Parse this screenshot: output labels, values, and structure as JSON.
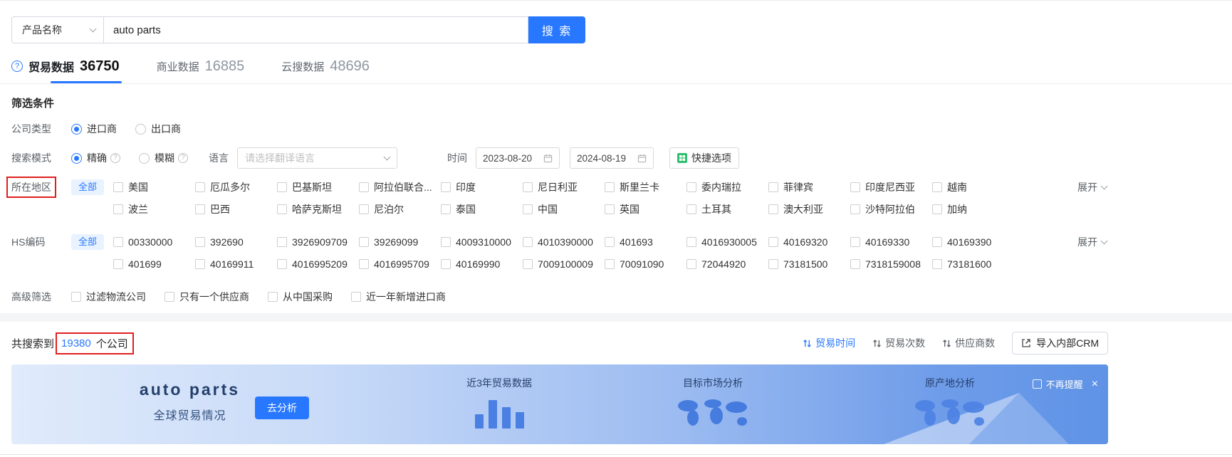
{
  "colors": {
    "primary": "#2878ff",
    "quick_icon_green": "#2fbf6e",
    "annotation_red": "#e01f1f"
  },
  "icons": {
    "help": "?",
    "info": "?",
    "close": "×"
  },
  "search_bar": {
    "category": "产品名称",
    "query": "auto parts",
    "button": "搜 索"
  },
  "tabs": [
    {
      "label": "贸易数据",
      "count": "36750"
    },
    {
      "label": "商业数据",
      "count": "16885"
    },
    {
      "label": "云搜数据",
      "count": "48696"
    }
  ],
  "filters": {
    "title": "筛选条件",
    "company_type": {
      "label": "公司类型",
      "options": [
        {
          "label": "进口商",
          "selected": true
        },
        {
          "label": "出口商",
          "selected": false
        }
      ]
    },
    "search_mode": {
      "label": "搜索模式",
      "options": [
        {
          "label": "精确",
          "selected": true
        },
        {
          "label": "模糊",
          "selected": false
        }
      ]
    },
    "language": {
      "label": "语言",
      "placeholder": "请选择翻译语言"
    },
    "time": {
      "label": "时间",
      "start": "2023-08-20",
      "end": "2024-08-19"
    },
    "quick_options_label": "快捷选项",
    "region": {
      "label": "所在地区",
      "all_label": "全部",
      "expand_label": "展开",
      "row1": [
        "美国",
        "厄瓜多尔",
        "巴基斯坦",
        "阿拉伯联合...",
        "印度",
        "尼日利亚",
        "斯里兰卡",
        "委内瑞拉",
        "菲律宾",
        "印度尼西亚",
        "越南"
      ],
      "row2": [
        "波兰",
        "巴西",
        "哈萨克斯坦",
        "尼泊尔",
        "泰国",
        "中国",
        "英国",
        "土耳其",
        "澳大利亚",
        "沙特阿拉伯",
        "加纳"
      ]
    },
    "hs_code": {
      "label": "HS编码",
      "all_label": "全部",
      "expand_label": "展开",
      "row1": [
        "00330000",
        "392690",
        "3926909709",
        "39269099",
        "4009310000",
        "4010390000",
        "401693",
        "4016930005",
        "40169320",
        "40169330",
        "40169390"
      ],
      "row2": [
        "401699",
        "40169911",
        "4016995209",
        "4016995709",
        "40169990",
        "7009100009",
        "70091090",
        "72044920",
        "73181500",
        "7318159008",
        "73181600"
      ]
    },
    "advanced": {
      "label": "高级筛选",
      "options": [
        "过滤物流公司",
        "只有一个供应商",
        "从中国采购",
        "近一年新增进口商"
      ]
    }
  },
  "results": {
    "prefix": "共搜索到",
    "count": "19380",
    "suffix": "个公司",
    "sorts": [
      "贸易时间",
      "贸易次数",
      "供应商数"
    ],
    "active_sort": "贸易时间",
    "crm_button": "导入内部CRM"
  },
  "banner": {
    "title": "auto parts",
    "subtitle": "全球贸易情况",
    "analyze": "去分析",
    "item1": "近3年贸易数据",
    "item2": "目标市场分析",
    "item3": "原产地分析",
    "dismiss": "不再提醒"
  }
}
